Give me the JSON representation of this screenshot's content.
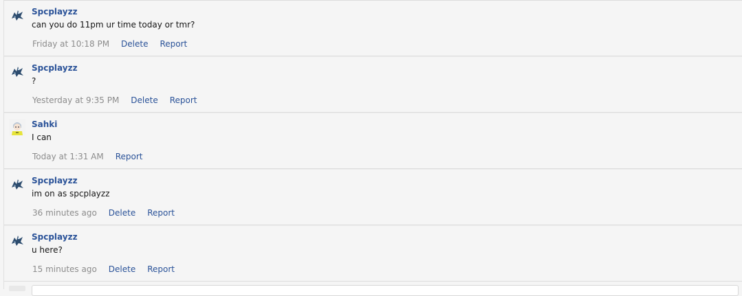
{
  "messages": [
    {
      "username": "Spcplayzz",
      "avatar": "dragon-avatar",
      "text": "can you do 11pm ur time today or tmr?",
      "time": "Friday at 10:18 PM",
      "delete_label": "Delete",
      "report_label": "Report"
    },
    {
      "username": "Spcplayzz",
      "avatar": "dragon-avatar",
      "text": "?",
      "time": "Yesterday at 9:35 PM",
      "delete_label": "Delete",
      "report_label": "Report"
    },
    {
      "username": "Sahki",
      "avatar": "anime-avatar",
      "text": "I can",
      "time": "Today at 1:31 AM",
      "report_label": "Report"
    },
    {
      "username": "Spcplayzz",
      "avatar": "dragon-avatar",
      "text": "im on as spcplayzz",
      "time": "36 minutes ago",
      "delete_label": "Delete",
      "report_label": "Report"
    },
    {
      "username": "Spcplayzz",
      "avatar": "dragon-avatar",
      "text": "u here?",
      "time": "15 minutes ago",
      "delete_label": "Delete",
      "report_label": "Report"
    }
  ],
  "colors": {
    "username": "#2a5298",
    "timestamp": "#8c8c8c",
    "action_link": "#2a5298",
    "background": "#f5f5f5"
  }
}
